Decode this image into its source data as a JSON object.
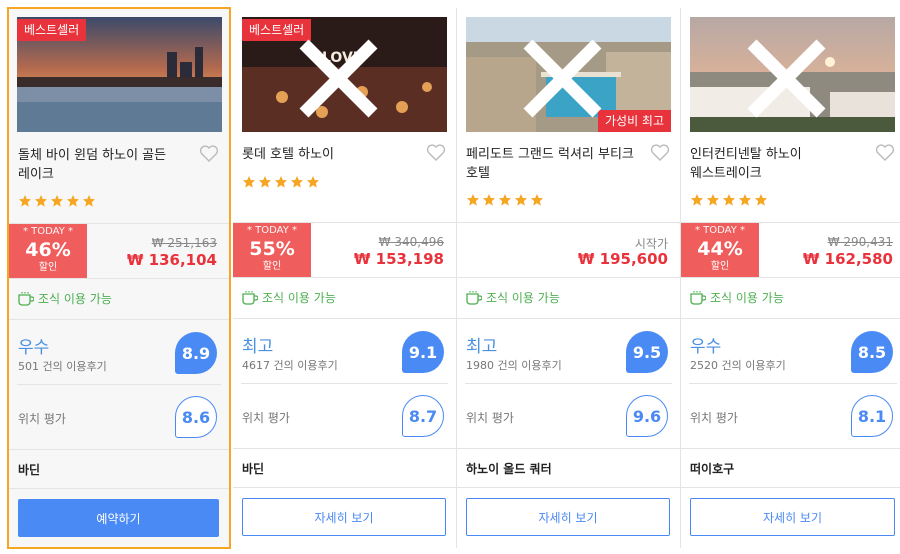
{
  "colors": {
    "accent": "#4a8af4",
    "sale_red": "#e8323c",
    "today_bg": "#ef5d5d",
    "highlight_border": "#f5a623",
    "breakfast_green": "#4caf50"
  },
  "hotels": [
    {
      "badge": "베스트셀러",
      "name": "롯데 호텔 하노이",
      "stars": 5,
      "today_label": "* TODAY *",
      "discount": "55%",
      "discount_sub": "할인",
      "original_price": "₩ 340,496",
      "price": "₩ 153,198",
      "breakfast": "조식 이용 가능",
      "rating_word": "최고",
      "reviews": "4617 건의 이용후기",
      "score": "9.1",
      "location_label": "위치 평가",
      "location_score": "8.7",
      "district": "바딘",
      "cta": "자세히 보기"
    },
    {
      "badge_value": "가성비 최고",
      "name": "페리도트 그랜드 럭셔리 부티크 호텔",
      "stars": 5,
      "from_label": "시작가",
      "price": "₩ 195,600",
      "breakfast": "조식 이용 가능",
      "rating_word": "최고",
      "reviews": "1980 건의 이용후기",
      "score": "9.5",
      "location_label": "위치 평가",
      "location_score": "9.6",
      "district": "하노이 올드 쿼터",
      "cta": "자세히 보기"
    },
    {
      "name": "인터컨티넨탈 하노이 웨스트레이크",
      "stars": 5,
      "today_label": "* TODAY *",
      "discount": "44%",
      "discount_sub": "할인",
      "original_price": "₩ 290,431",
      "price": "₩ 162,580",
      "breakfast": "조식 이용 가능",
      "rating_word": "우수",
      "reviews": "2520 건의 이용후기",
      "score": "8.5",
      "location_label": "위치 평가",
      "location_score": "8.1",
      "district": "떠이호구",
      "cta": "자세히 보기"
    }
  ],
  "featured": {
    "badge": "베스트셀러",
    "name": "돌체 바이 윈덤 하노이 골든 레이크",
    "stars": 5,
    "today_label": "* TODAY *",
    "discount": "46%",
    "discount_sub": "할인",
    "original_price": "₩ 251,163",
    "price": "₩ 136,104",
    "breakfast": "조식 이용 가능",
    "rating_word": "우수",
    "reviews": "501 건의 이용후기",
    "score": "8.9",
    "location_label": "위치 평가",
    "location_score": "8.6",
    "district": "바딘",
    "cta": "예약하기"
  }
}
